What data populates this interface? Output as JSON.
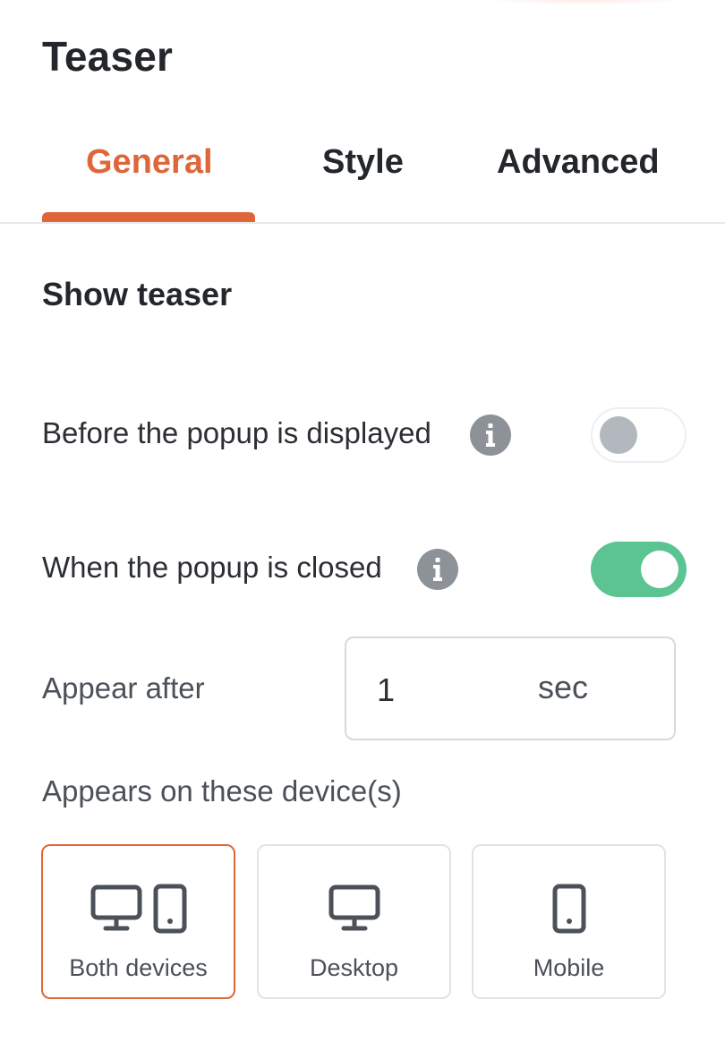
{
  "panel": {
    "title": "Teaser"
  },
  "tabs": [
    {
      "label": "General",
      "active": true
    },
    {
      "label": "Style",
      "active": false
    },
    {
      "label": "Advanced",
      "active": false
    }
  ],
  "section": {
    "title": "Show teaser"
  },
  "settings": {
    "before_popup": {
      "label": "Before the popup is displayed",
      "enabled": false,
      "icon": "info-icon"
    },
    "when_closed": {
      "label": "When the popup is closed",
      "enabled": true,
      "icon": "info-icon"
    }
  },
  "appear_after": {
    "label": "Appear after",
    "value": "1",
    "unit": "sec"
  },
  "devices": {
    "label": "Appears on these device(s)",
    "options": [
      {
        "label": "Both devices",
        "icons": [
          "desktop-icon",
          "mobile-icon"
        ],
        "selected": true
      },
      {
        "label": "Desktop",
        "icons": [
          "desktop-icon"
        ],
        "selected": false
      },
      {
        "label": "Mobile",
        "icons": [
          "mobile-icon"
        ],
        "selected": false
      }
    ]
  },
  "colors": {
    "accent": "#e0663a",
    "toggle_on": "#5bc492",
    "toggle_off_knob": "#b3b8bf",
    "info_icon": "#8d9299"
  }
}
